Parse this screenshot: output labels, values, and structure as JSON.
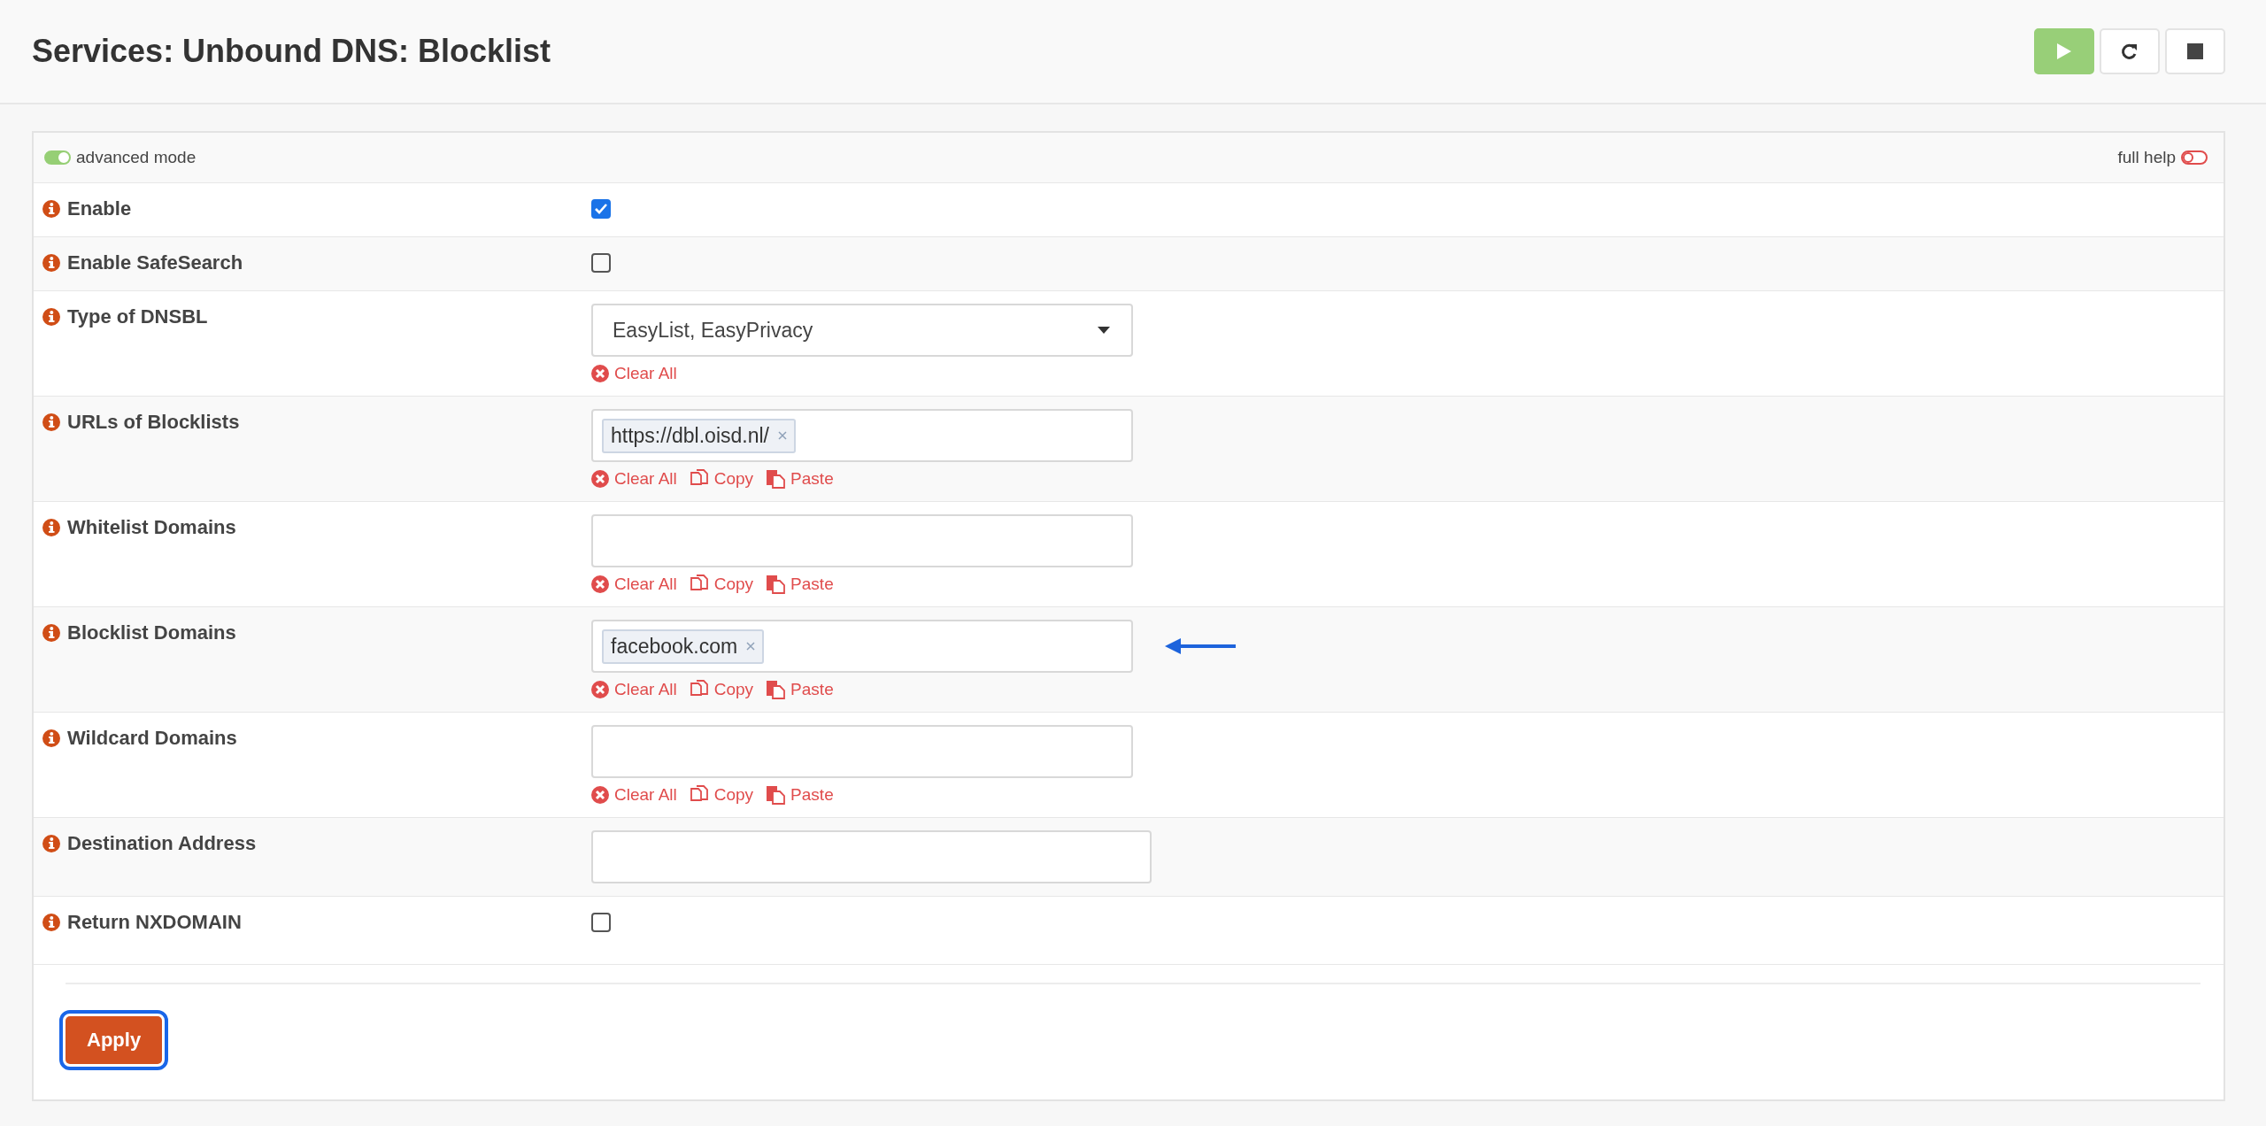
{
  "title": "Services: Unbound DNS: Blocklist",
  "header_buttons": [
    {
      "kind": "play"
    },
    {
      "kind": "reload"
    },
    {
      "kind": "stop"
    }
  ],
  "toolbar": {
    "advanced_mode": {
      "label": "advanced mode",
      "on": true
    },
    "full_help": {
      "label": "full help",
      "on": false
    }
  },
  "fields": [
    {
      "kind": "checkbox",
      "label": "Enable",
      "checked": true
    },
    {
      "kind": "checkbox",
      "label": "Enable SafeSearch",
      "checked": false
    },
    {
      "kind": "select",
      "label": "Type of DNSBL",
      "value": "EasyList, EasyPrivacy",
      "actions": [
        {
          "kind": "clear",
          "label": "Clear All"
        }
      ]
    },
    {
      "kind": "tags",
      "label": "URLs of Blocklists",
      "tags": [
        "https://dbl.oisd.nl/"
      ],
      "actions": [
        {
          "kind": "clear",
          "label": "Clear All"
        },
        {
          "kind": "copy",
          "label": "Copy"
        },
        {
          "kind": "paste",
          "label": "Paste"
        }
      ]
    },
    {
      "kind": "tags",
      "label": "Whitelist Domains",
      "actions": [
        {
          "kind": "clear",
          "label": "Clear All"
        },
        {
          "kind": "copy",
          "label": "Copy"
        },
        {
          "kind": "paste",
          "label": "Paste"
        }
      ]
    },
    {
      "kind": "tags",
      "label": "Blocklist Domains",
      "tags": [
        "facebook.com"
      ],
      "pointer": true,
      "actions": [
        {
          "kind": "clear",
          "label": "Clear All"
        },
        {
          "kind": "copy",
          "label": "Copy"
        },
        {
          "kind": "paste",
          "label": "Paste"
        }
      ]
    },
    {
      "kind": "tags",
      "label": "Wildcard Domains",
      "actions": [
        {
          "kind": "clear",
          "label": "Clear All"
        },
        {
          "kind": "copy",
          "label": "Copy"
        },
        {
          "kind": "paste",
          "label": "Paste"
        }
      ]
    },
    {
      "kind": "text",
      "label": "Destination Address"
    },
    {
      "kind": "checkbox",
      "label": "Return NXDOMAIN",
      "checked": false
    }
  ],
  "apply": {
    "label": "Apply",
    "focused": true
  }
}
